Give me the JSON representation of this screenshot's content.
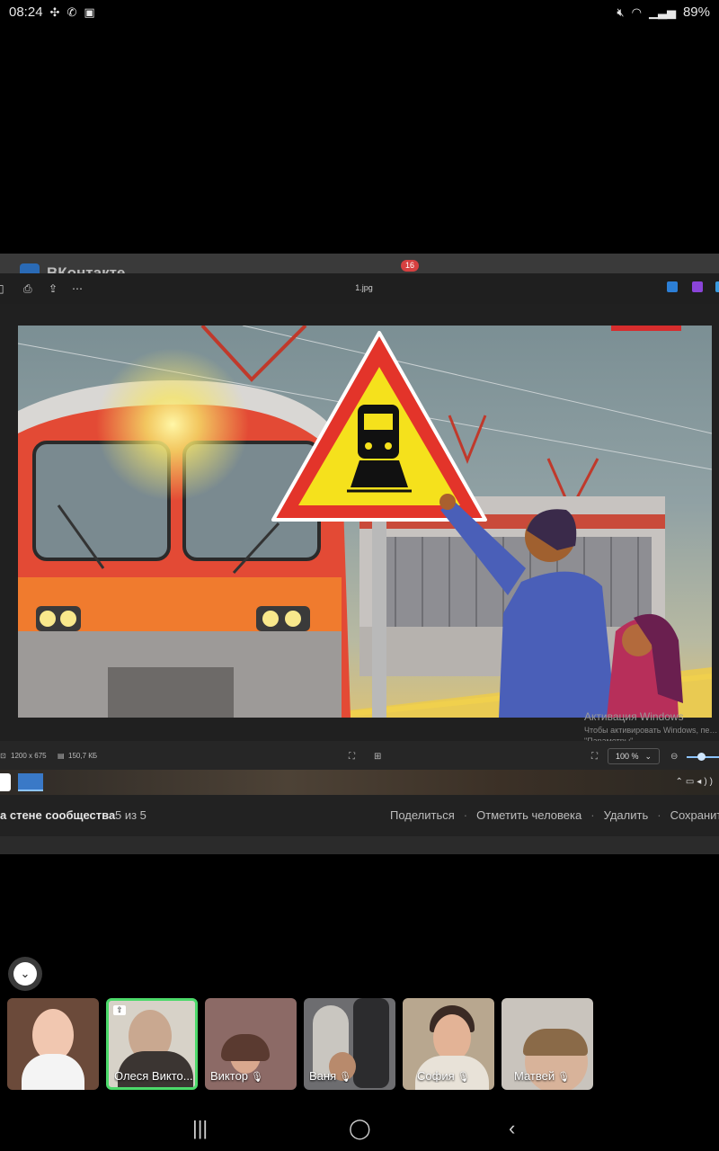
{
  "status_bar": {
    "time": "08:24",
    "battery": "89%",
    "left_icons": [
      "grid-icon",
      "phone-icon",
      "image-icon"
    ],
    "right_icons": [
      "mute-icon",
      "wifi-icon",
      "signal-icon"
    ]
  },
  "vk": {
    "site_name": "ВКонтакте",
    "notification_count": "16"
  },
  "viewer": {
    "file_name": "1.jpg",
    "dimensions": "1200 x 675",
    "file_size": "150,7 КБ",
    "zoom": "100 %"
  },
  "windows_activation": {
    "title": "Активация Windows",
    "subtitle": "Чтобы активировать Windows, пе… \"Параметры\"."
  },
  "vk_photo_bar": {
    "caption": "а стене сообщества",
    "counter": "5 из 5",
    "actions": [
      "Поделиться",
      "Отметить человека",
      "Удалить",
      "Сохранить"
    ]
  },
  "participants": [
    {
      "name": "",
      "muted": false,
      "active": false,
      "bg": "#6b4a3a"
    },
    {
      "name": "Олеся Викто...",
      "muted": false,
      "active": true,
      "bg": "#d7d2c8"
    },
    {
      "name": "Виктор",
      "muted": true,
      "active": false,
      "bg": "#8c6a66"
    },
    {
      "name": "Ваня",
      "muted": true,
      "active": false,
      "bg": "#6d6d70"
    },
    {
      "name": "София",
      "muted": true,
      "active": false,
      "bg": "#b8a78f"
    },
    {
      "name": "Матвей",
      "muted": true,
      "active": false,
      "bg": "#c9c4bd"
    }
  ],
  "nav": [
    "recents-icon",
    "home-icon",
    "back-icon"
  ]
}
